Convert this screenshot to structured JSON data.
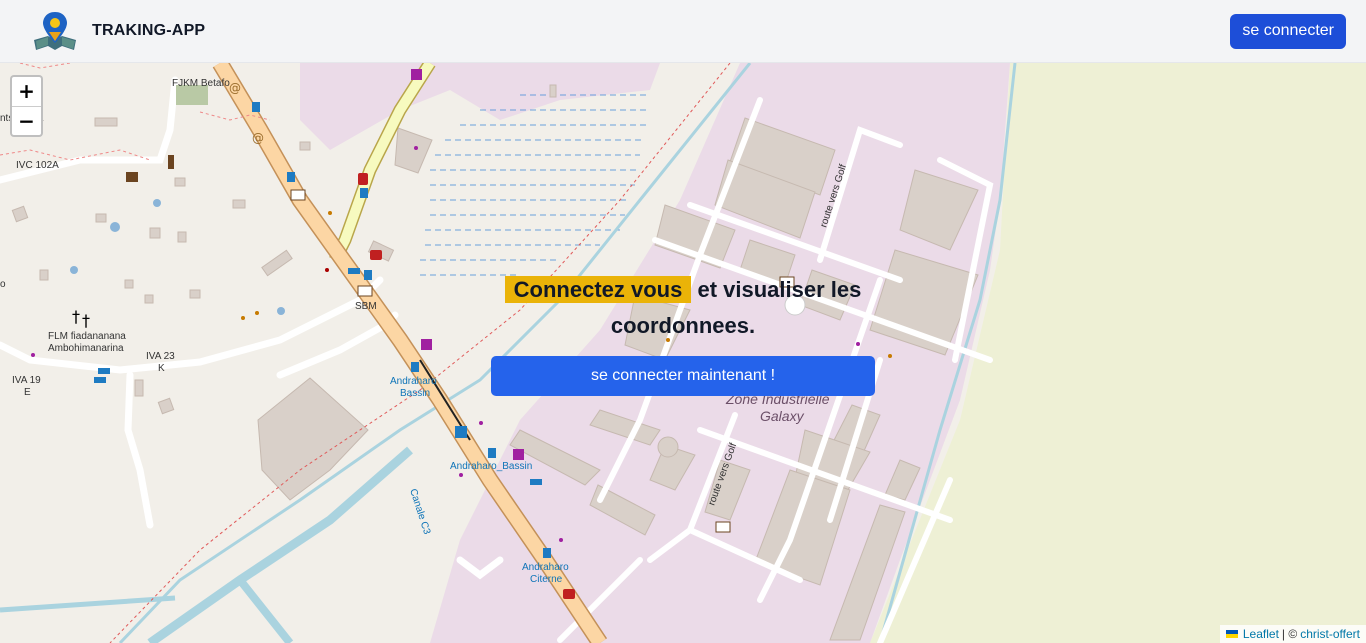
{
  "app": {
    "name": "TRAKING-APP",
    "logo_icon": "map-pin-book-logo",
    "login_label": "se connecter"
  },
  "hero": {
    "highlight": "Connectez vous",
    "rest_line1": " et visualiser les",
    "line2": "coordonnees.",
    "cta_label": "se connecter maintenant !"
  },
  "map": {
    "zoom_in": "+",
    "zoom_out": "−",
    "labels": {
      "fjkm": "FJKM Betafo",
      "asina": "nts-   asina",
      "ivc": "IVC 102A",
      "flm1": "FLM fiadananana",
      "flm2": "Ambohimanarina",
      "iva23": "IVA 23",
      "iva23b": "K",
      "iva19": "IVA 19",
      "iva19b": "E",
      "o": "o",
      "sbm": "SBM",
      "bassin1": "Andraharo",
      "bassin2": "Bassin",
      "bassin3": "Andraharo_Bassin",
      "citerne1": "Andraharo",
      "citerne2": "Citerne",
      "zone1": "Zone Industrielle",
      "zone2": "Galaxy",
      "golf": "route vers Golf",
      "canal": "Canale C3"
    },
    "attribution": {
      "leaflet": "Leaflet",
      "separator": "| ©",
      "owner": "christ-offert"
    }
  },
  "colors": {
    "primary": "#2563eb",
    "nav_button": "#1d4ed8",
    "highlight": "#eab308",
    "map_bg": "#f2efe9",
    "industrial": "#ebdbe8",
    "road_primary": "#fcd6a4",
    "water": "#aad3df"
  }
}
